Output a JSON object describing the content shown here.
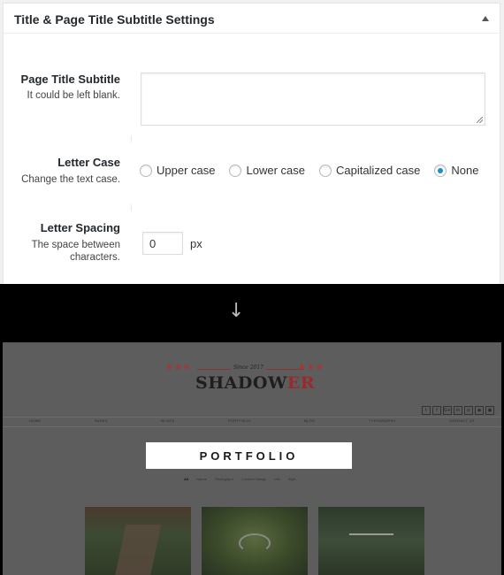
{
  "metabox": {
    "title": "Title & Page Title Subtitle Settings",
    "toggle_icon": "triangle-up-icon"
  },
  "subtitle_field": {
    "label": "Page Title Subtitle",
    "description": "It could be left blank.",
    "value": ""
  },
  "letter_case": {
    "label": "Letter Case",
    "description": "Change the text case.",
    "options": [
      {
        "label": "Upper case",
        "checked": false
      },
      {
        "label": "Lower case",
        "checked": false
      },
      {
        "label": "Capitalized case",
        "checked": false
      },
      {
        "label": "None",
        "checked": true
      }
    ]
  },
  "letter_spacing": {
    "label": "Letter Spacing",
    "description_line1": "The space between",
    "description_line2": "characters.",
    "value": "0",
    "unit": "px"
  },
  "arrow_glyph": "↓",
  "preview": {
    "stars": "★★★",
    "since": "Since 2017",
    "logo_main": "SHADOW",
    "logo_accent": "ER",
    "accent_color": "#9a2a2a",
    "nav": [
      "HOME",
      "PAGES",
      "BLOGS",
      "PORTFOLIO",
      "BLOG",
      "TYPOGRAPHY",
      "CONTACT US"
    ],
    "social_icons": [
      "t",
      "f",
      "G+",
      "in",
      "◎",
      "◉",
      "▣"
    ],
    "banner_title": "PORTFOLIO",
    "filters": [
      "All",
      "Nature",
      "Photograph",
      "Creative Design",
      "Life",
      "Style"
    ]
  }
}
